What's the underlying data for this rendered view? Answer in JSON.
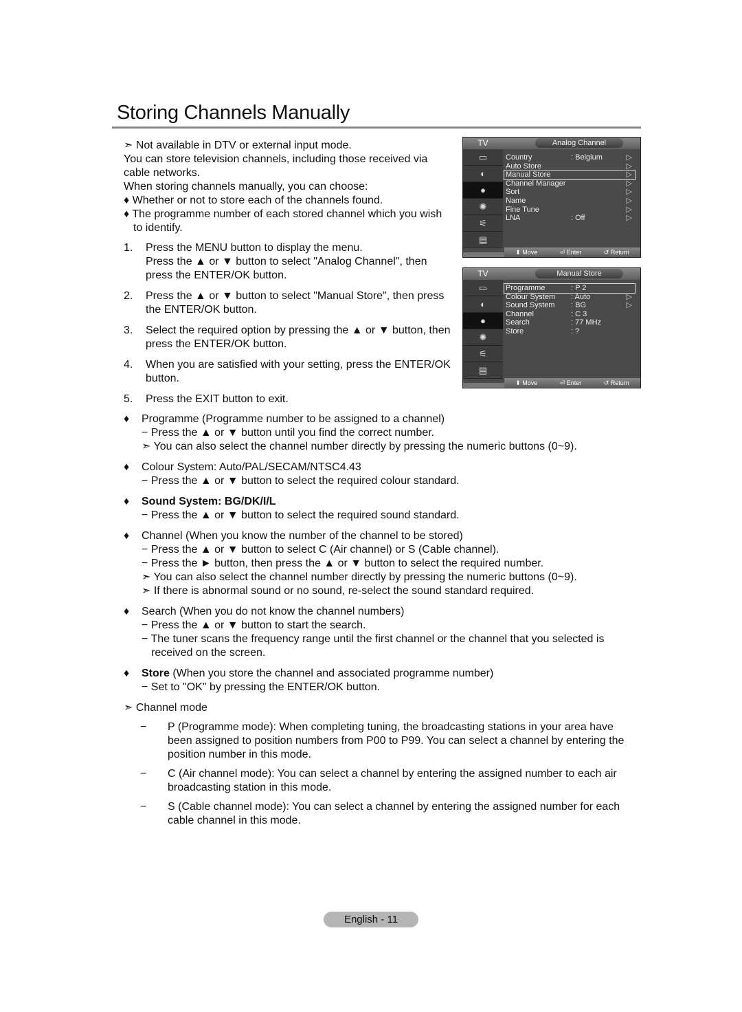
{
  "page": {
    "title": "Storing Channels Manually",
    "footer": "English - 11"
  },
  "intro": {
    "note": "➣ Not available in DTV or external input mode.",
    "p1": "You can store television channels, including those received via cable networks.",
    "p2": "When storing channels manually, you can choose:",
    "bullet1": "♦ Whether or not to store each of the channels found.",
    "bullet2": "♦ The programme number of each stored channel which you wish",
    "bullet2_cont": "to identify."
  },
  "steps": [
    {
      "num": "1.",
      "text": "Press the MENU button to display the menu.",
      "text2": "Press the ▲ or ▼ button to select \"Analog Channel\", then press the ENTER/OK button."
    },
    {
      "num": "2.",
      "text": "Press the ▲ or ▼ button to select \"Manual Store\", then press the ENTER/OK button."
    },
    {
      "num": "3.",
      "text": "Select the required option by pressing the ▲ or ▼ button, then press the ENTER/OK button."
    },
    {
      "num": "4.",
      "text": "When you are satisfied with your setting, press the ENTER/OK button."
    },
    {
      "num": "5.",
      "text": "Press the EXIT button to exit."
    }
  ],
  "details": {
    "programme": {
      "head": "Programme  (Programme number to be assigned to a channel)",
      "sub1": "− Press the ▲ or ▼ button until you find the correct number.",
      "sub2": "➣ You can also select the channel number directly by pressing the numeric buttons (0~9)."
    },
    "colour": {
      "head": "Colour System: Auto/PAL/SECAM/NTSC4.43",
      "sub1": "− Press the ▲ or ▼ button to select the required colour standard."
    },
    "sound": {
      "head": "Sound System: BG/DK/I/L",
      "sub1": "− Press the ▲ or ▼ button to select the required sound standard."
    },
    "channel": {
      "head": "Channel  (When you know the number of the channel to be stored)",
      "sub1": "− Press the ▲ or ▼ button to select C (Air channel) or S (Cable channel).",
      "sub2": "− Press the ► button, then press the ▲ or ▼ button to select the required number.",
      "sub3": "➣ You can also select the channel number directly by pressing the numeric buttons (0~9).",
      "sub4": "➣ If there is abnormal sound or no sound, re-select the sound standard required."
    },
    "search": {
      "head": "Search  (When you do not know the channel numbers)",
      "sub1": "− Press the ▲ or ▼ button to start the search.",
      "sub2": "− The tuner scans the frequency range until the first channel or the channel that you selected is",
      "sub2_cont": "received on the screen."
    },
    "store": {
      "head_bold": "Store",
      "head_rest": " (When you store the channel and associated programme number)",
      "sub1": "− Set to \"OK\" by pressing the ENTER/OK button."
    },
    "channel_mode": {
      "head": "➣ Channel mode",
      "items": [
        {
          "dash": "−",
          "text": "P (Programme mode): When completing tuning, the broadcasting stations in your area have been assigned to position numbers from P00 to P99. You can select a channel by entering the position number in this mode."
        },
        {
          "dash": "−",
          "text": "C (Air channel mode): You can select a channel by entering the assigned number to each air broadcasting station in this mode."
        },
        {
          "dash": "−",
          "text": "S (Cable channel mode): You can select a channel by entering the assigned number for each cable channel in this mode."
        }
      ]
    },
    "diamond": "♦"
  },
  "osd_analog": {
    "tv": "TV",
    "title": "Analog Channel",
    "rows": [
      {
        "label": "Country",
        "value": ": Belgium",
        "arrow": "▷"
      },
      {
        "label": "Auto Store",
        "value": "",
        "arrow": "▷"
      },
      {
        "label": "Manual Store",
        "value": "",
        "arrow": "▷",
        "selected": true
      },
      {
        "label": "Channel Manager",
        "value": "",
        "arrow": "▷"
      },
      {
        "label": "Sort",
        "value": "",
        "arrow": "▷"
      },
      {
        "label": "Name",
        "value": "",
        "arrow": "▷"
      },
      {
        "label": "Fine Tune",
        "value": "",
        "arrow": "▷"
      },
      {
        "label": "LNA",
        "value": ": Off",
        "arrow": "▷"
      }
    ],
    "footer": {
      "move": "⬍ Move",
      "enter": "⏎ Enter",
      "return": "↺ Return"
    }
  },
  "osd_manual": {
    "tv": "TV",
    "title": "Manual Store",
    "rows": [
      {
        "label": "Programme",
        "value": ": P 2",
        "arrow": "",
        "selected": true
      },
      {
        "label": "Colour System",
        "value": ": Auto",
        "arrow": "▷"
      },
      {
        "label": "Sound System",
        "value": ": BG",
        "arrow": "▷"
      },
      {
        "label": "Channel",
        "value": ": C 3",
        "arrow": ""
      },
      {
        "label": "Search",
        "value": ": 77 MHz",
        "arrow": ""
      },
      {
        "label": "Store",
        "value": ": ?",
        "arrow": ""
      }
    ],
    "footer": {
      "move": "⬍ Move",
      "enter": "⏎ Enter",
      "return": "↺ Return"
    }
  },
  "osd_side_icons": [
    "picture-icon",
    "sound-icon",
    "channel-icon",
    "setup-icon",
    "input-icon",
    "application-icon"
  ],
  "osd_side_glyphs": [
    "▭",
    "◐",
    "●",
    "✺",
    "⚟",
    "▤"
  ]
}
